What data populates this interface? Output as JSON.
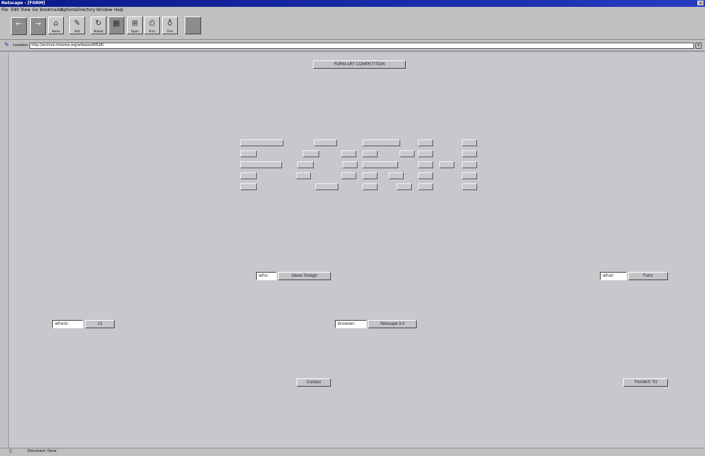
{
  "window": {
    "title": "Netscape - [FORM]"
  },
  "menu": [
    "File",
    "Edit",
    "View",
    "Go",
    "Bookmarks",
    "Options",
    "Directory",
    "Window",
    "Help"
  ],
  "toolbar": {
    "buttons": [
      {
        "label": "",
        "icon": "back-arrow-icon"
      },
      {
        "label": "",
        "icon": "forward-arrow-icon"
      },
      {
        "label": "Home",
        "icon": "home-icon"
      },
      {
        "label": "Edit",
        "icon": "pencil-icon"
      },
      {
        "label": "Reload",
        "icon": "reload-icon"
      },
      {
        "label": "",
        "icon": "images-icon"
      },
      {
        "label": "Open",
        "icon": "open-icon"
      },
      {
        "label": "Print",
        "icon": "printer-icon"
      },
      {
        "label": "Find",
        "icon": "binoculars-icon"
      },
      {
        "label": "",
        "icon": "stop-icon"
      }
    ]
  },
  "location": {
    "label": "Location:",
    "url": "http://archive.rhizome.org/artbase/40526/"
  },
  "page": {
    "title_button": "FORM ART COMPETITION",
    "who_field": "who:",
    "who_value": "Alexei Shulgin",
    "what_field": "what:",
    "what_value": "Form",
    "where_field": "where:",
    "where_value": "c3",
    "browser_field": "browser:",
    "browser_value": "Netscape 3.0",
    "contact_button": "Contact",
    "thanks_button": "THANKS TO"
  },
  "status": {
    "text": "Document: Done"
  }
}
